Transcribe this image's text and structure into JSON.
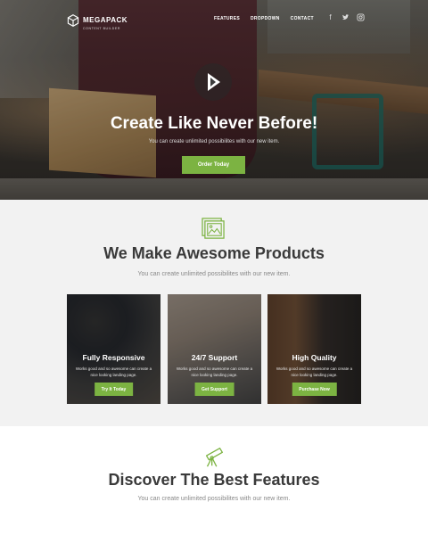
{
  "brand": {
    "name": "MEGAPACK",
    "tagline": "CONTENT BUILDER"
  },
  "nav": {
    "items": [
      "FEATURES",
      "DROPDOWN",
      "CONTACT"
    ]
  },
  "social": [
    "facebook-icon",
    "twitter-icon",
    "instagram-icon"
  ],
  "hero": {
    "title": "Create Like Never Before!",
    "subtitle": "You can create unlimited possibilites with our new item.",
    "button": "Order Today"
  },
  "products": {
    "title": "We Make Awesome Products",
    "subtitle": "You can create unlimited possibilites with our new item.",
    "cards": [
      {
        "title": "Fully Responsive",
        "text": "Works good and so awesome can create a nice looking landing page.",
        "button": "Try It Today"
      },
      {
        "title": "24/7 Support",
        "text": "Works good and so awesome can create a nice looking landing page.",
        "button": "Get Support"
      },
      {
        "title": "High Quality",
        "text": "Works good and so awesome can create a nice looking landing page.",
        "button": "Purchase Now"
      }
    ]
  },
  "features": {
    "title": "Discover The Best Features",
    "subtitle": "You can create unlimited possibilites with our new item."
  },
  "colors": {
    "accent": "#7cb342"
  }
}
